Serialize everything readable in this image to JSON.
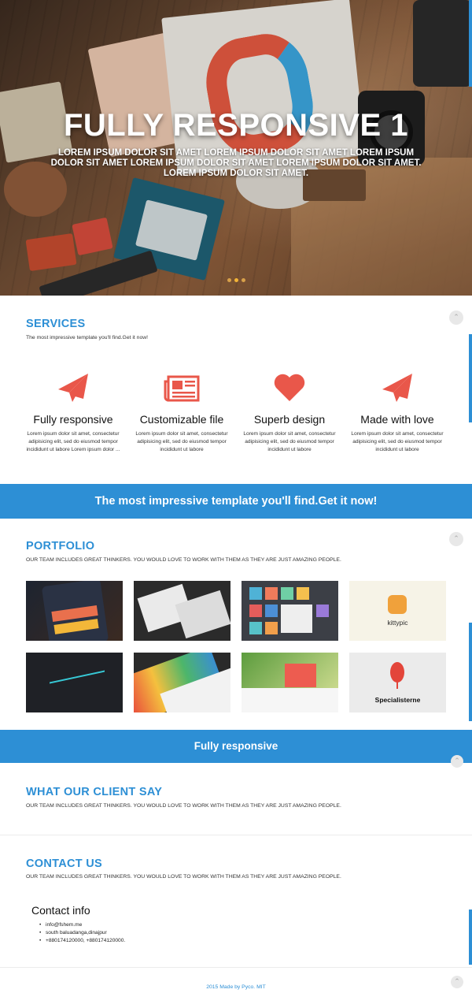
{
  "hero": {
    "title": "FULLY RESPONSIVE 1",
    "subtitle": "LOREM IPSUM DOLOR SIT AMET LOREM IPSUM DOLOR SIT AMET LOREM IPSUM DOLOR SIT AMET LOREM IPSUM DOLOR SIT AMET LOREM IPSUM DOLOR SIT AMET. LOREM IPSUM DOLOR SIT AMET.",
    "slides": 3,
    "active_slide": 1
  },
  "services": {
    "title": "SERVICES",
    "subtitle": "The most impressive template you'll find.Get it now!",
    "items": [
      {
        "icon": "paper-plane-icon",
        "title": "Fully responsive",
        "text": "Lorem ipsum dolor sit amet, consectetur adipisicing elit, sed do eiusmod tempor incididunt ut labore Lorem ipsum dolor ..."
      },
      {
        "icon": "newspaper-icon",
        "title": "Customizable file",
        "text": "Lorem ipsum dolor sit amet, consectetur adipisicing elit, sed do eiusmod tempor incididunt ut labore"
      },
      {
        "icon": "heart-icon",
        "title": "Superb design",
        "text": "Lorem ipsum dolor sit amet, consectetur adipisicing elit, sed do eiusmod tempor incididunt ut labore"
      },
      {
        "icon": "paper-plane-icon",
        "title": "Made with love",
        "text": "Lorem ipsum dolor sit amet, consectetur adipisicing elit, sed do eiusmod tempor incididunt ut labore"
      }
    ]
  },
  "banner1": {
    "text": "The most impressive template you'll find.Get it now!"
  },
  "portfolio": {
    "title": "PORTFOLIO",
    "subtitle": "OUR TEAM INCLUDES GREAT THINKERS. YOU WOULD LOVE TO WORK WITH THEM AS THEY ARE JUST AMAZING PEOPLE.",
    "logo_kittypic": "kittypic",
    "logo_specialisterne": "Specialisterne"
  },
  "banner2": {
    "text": "Fully responsive"
  },
  "testimonials": {
    "title": "WHAT OUR CLIENT SAY",
    "subtitle": "OUR TEAM INCLUDES GREAT THINKERS. YOU WOULD LOVE TO WORK WITH THEM AS THEY ARE JUST AMAZING PEOPLE."
  },
  "contact": {
    "title": "CONTACT US",
    "subtitle": "OUR TEAM INCLUDES GREAT THINKERS. YOU WOULD LOVE TO WORK WITH THEM AS THEY ARE JUST AMAZING PEOPLE.",
    "info_heading": "Contact info",
    "email": "info@fshem.me",
    "address": "south baluadanga,dinajpur",
    "phones": "+880174120000, +880174120000."
  },
  "footer": {
    "text": "2015 Made by Pyco. MIT"
  },
  "colors": {
    "accent": "#2d8fd5",
    "icon": "#e9574a",
    "dot": "#f3b437"
  },
  "icons": {
    "scroll_up": "chevron-up-icon"
  }
}
